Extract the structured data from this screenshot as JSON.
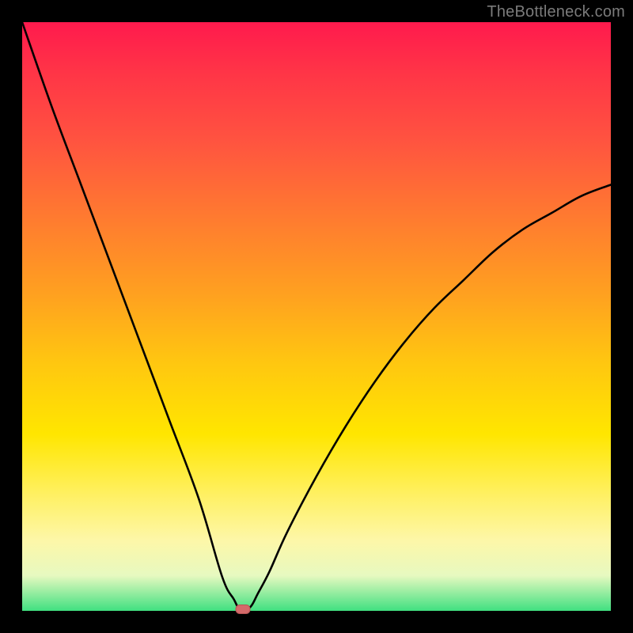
{
  "watermark": "TheBottleneck.com",
  "colors": {
    "frame_bg": "#000000",
    "curve_stroke": "#000000",
    "marker_fill": "#d46a6a",
    "gradient_top": "#ff1a4d",
    "gradient_bottom": "#40e080"
  },
  "chart_data": {
    "type": "line",
    "title": "",
    "xlabel": "",
    "ylabel": "",
    "xlim": [
      0,
      100
    ],
    "ylim": [
      0,
      105
    ],
    "grid": false,
    "legend": false,
    "note": "Absolute-value style bottleneck curve. Values estimated from pixels; no axis ticks shown.",
    "series": [
      {
        "name": "bottleneck_percent",
        "x": [
          0,
          5,
          10,
          15,
          20,
          25,
          30,
          34,
          36,
          37,
          38,
          39,
          40,
          42,
          45,
          50,
          55,
          60,
          65,
          70,
          75,
          80,
          85,
          90,
          95,
          100
        ],
        "y": [
          105,
          90,
          76,
          62,
          48,
          34,
          20,
          6,
          2,
          0,
          0,
          1,
          3,
          7,
          14,
          24,
          33,
          41,
          48,
          54,
          59,
          64,
          68,
          71,
          74,
          76
        ]
      }
    ],
    "marker": {
      "x": 37.5,
      "y": 0,
      "shape": "rounded-rect"
    }
  }
}
